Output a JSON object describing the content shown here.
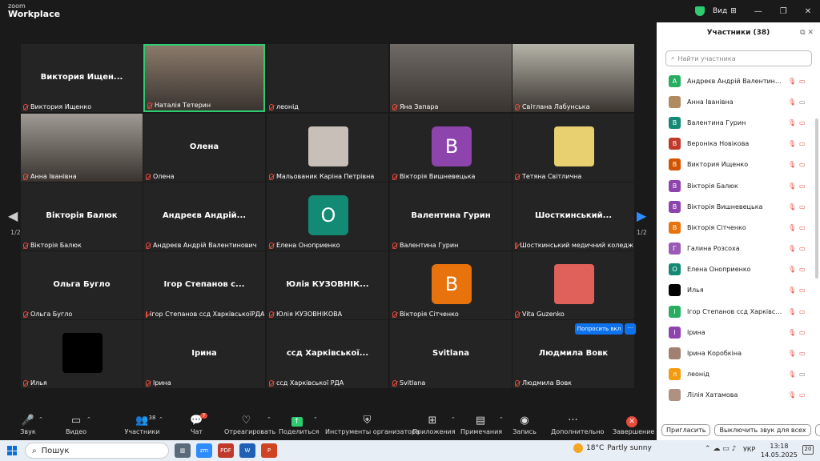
{
  "app": {
    "logo_top": "zoom",
    "logo_bottom": "Workplace",
    "view_label": "Вид",
    "win_controls": [
      "—",
      "❐",
      "✕"
    ]
  },
  "tiles": [
    {
      "name": "Виктория Ищен...",
      "label": "Виктория Ищенко",
      "kind": "name"
    },
    {
      "name": "",
      "label": "Наталія Тетерин",
      "kind": "video",
      "bg": "#8a7a6a",
      "active": true
    },
    {
      "name": "",
      "label": "леонід",
      "kind": "blank"
    },
    {
      "name": "",
      "label": "Яна Запара",
      "kind": "video",
      "bg": "#6f6a66"
    },
    {
      "name": "",
      "label": "Світлана Лабунська",
      "kind": "video",
      "bg": "#b5b4a8"
    },
    {
      "name": "",
      "label": "Анна Іванівна",
      "kind": "video",
      "bg": "#a09a94"
    },
    {
      "name": "Олена",
      "label": "Олена",
      "kind": "name"
    },
    {
      "name": "",
      "label": "Мальованик Каріна Петрівна",
      "kind": "thumb",
      "bg": "#c8c0b8"
    },
    {
      "name": "В",
      "label": "Вікторія Вишневецька",
      "kind": "avatar",
      "bg": "#8e44ad"
    },
    {
      "name": "",
      "label": "Тетяна Світлична",
      "kind": "thumb",
      "bg": "#e8d070"
    },
    {
      "name": "Вікторія Балюк",
      "label": "Вікторія Балюк",
      "kind": "name"
    },
    {
      "name": "Андреєв Андрій...",
      "label": "Андреєв Андрій Валентинович",
      "kind": "name"
    },
    {
      "name": "О",
      "label": "Елена Оноприенко",
      "kind": "avatar",
      "bg": "#138a74"
    },
    {
      "name": "Валентина Гурин",
      "label": "Валентина Гурин",
      "kind": "name"
    },
    {
      "name": "Шосткинський...",
      "label": "Шосткинський медичний коледж",
      "kind": "name"
    },
    {
      "name": "Ольга Бугло",
      "label": "Ольга Бугло",
      "kind": "name"
    },
    {
      "name": "Ігор Степанов с...",
      "label": "Ігор Степанов ссд ХарківськоїРДА",
      "kind": "name"
    },
    {
      "name": "Юлія КУЗОВНІК...",
      "label": "Юлія КУЗОВНІКОВА",
      "kind": "name"
    },
    {
      "name": "В",
      "label": "Вікторія Сітченко",
      "kind": "avatar",
      "bg": "#e8720c"
    },
    {
      "name": "",
      "label": "Vita Guzenko",
      "kind": "thumb",
      "bg": "#e0605a"
    },
    {
      "name": "",
      "label": "Илья",
      "kind": "thumb",
      "bg": "#000000"
    },
    {
      "name": "Ірина",
      "label": "Ірина",
      "kind": "name"
    },
    {
      "name": "ссд Харківської...",
      "label": "ссд Харківської РДА",
      "kind": "name"
    },
    {
      "name": "Svitlana",
      "label": "Svitlana",
      "kind": "name"
    },
    {
      "name": "Людмила Вовк",
      "label": "Людмила Вовк",
      "kind": "name"
    }
  ],
  "stage": {
    "page_left": "1/2",
    "page_right": "1/2",
    "ask_button": "Попросить вкл",
    "more": "···"
  },
  "toolbar": [
    {
      "label": "Звук",
      "icon": "🎤",
      "caret": true
    },
    {
      "label": "Видео",
      "icon": "▭",
      "caret": true
    },
    {
      "label": "Участники",
      "icon": "👥",
      "caret": true,
      "count": "38"
    },
    {
      "label": "Чат",
      "icon": "💬",
      "caret": false,
      "badge": "7"
    },
    {
      "label": "Отреагировать",
      "icon": "♡",
      "caret": true
    },
    {
      "label": "Поделиться",
      "icon": "↑",
      "caret": true
    },
    {
      "label": "Инструменты организатора",
      "icon": "⛨",
      "caret": false
    },
    {
      "label": "Приложения",
      "icon": "⊞",
      "caret": true
    },
    {
      "label": "Примечания",
      "icon": "▤",
      "caret": true
    },
    {
      "label": "Запись",
      "icon": "◉",
      "caret": false
    },
    {
      "label": "Дополнительно",
      "icon": "···",
      "caret": false
    },
    {
      "label": "Завершение",
      "icon": "✕",
      "caret": false
    }
  ],
  "panel": {
    "title": "Участники (38)",
    "search_placeholder": "Найти участника",
    "participants": [
      {
        "initial": "А",
        "name": "Андреєв Андрій Валентинович",
        "color": "#27ae60",
        "cam_on": false
      },
      {
        "initial": "",
        "name": "Анна Іванівна",
        "color": "#b08a60",
        "cam_on": true
      },
      {
        "initial": "В",
        "name": "Валентина Гурин",
        "color": "#138a74",
        "cam_on": false
      },
      {
        "initial": "В",
        "name": "Вероніка Новікова",
        "color": "#c0392b",
        "cam_on": false
      },
      {
        "initial": "В",
        "name": "Виктория Ищенко",
        "color": "#d35400",
        "cam_on": false
      },
      {
        "initial": "В",
        "name": "Вікторія Балюк",
        "color": "#8e44ad",
        "cam_on": false
      },
      {
        "initial": "В",
        "name": "Вікторія Вишневецька",
        "color": "#8e44ad",
        "cam_on": false
      },
      {
        "initial": "В",
        "name": "Вікторія Сітченко",
        "color": "#e8720c",
        "cam_on": false
      },
      {
        "initial": "Г",
        "name": "Галина Розсоха",
        "color": "#9b59b6",
        "cam_on": false
      },
      {
        "initial": "О",
        "name": "Елена Оноприенко",
        "color": "#138a74",
        "cam_on": false
      },
      {
        "initial": "",
        "name": "Илья",
        "color": "#000000",
        "cam_on": false
      },
      {
        "initial": "І",
        "name": "Ігор Степанов ссд Харківської...",
        "color": "#27ae60",
        "cam_on": false
      },
      {
        "initial": "І",
        "name": "Ірина",
        "color": "#8e44ad",
        "cam_on": false
      },
      {
        "initial": "",
        "name": "Ірина Коробкіна",
        "color": "#a08070",
        "cam_on": false
      },
      {
        "initial": "л",
        "name": "леонід",
        "color": "#f39c12",
        "cam_on": true
      },
      {
        "initial": "",
        "name": "Лілія Хатамова",
        "color": "#b09080",
        "cam_on": false
      }
    ],
    "invite": "Пригласить",
    "mute_all": "Выключить звук для всех",
    "more": "···"
  },
  "taskbar": {
    "search": "Пошук",
    "weather_temp": "18°C",
    "weather_desc": "Partly sunny",
    "lang": "УКР",
    "time": "13:18",
    "date": "14.05.2025",
    "notif": "20",
    "apps": [
      {
        "label": "zm",
        "color": "#2d8cff"
      },
      {
        "label": "PDF",
        "color": "#c0392b"
      },
      {
        "label": "W",
        "color": "#1f5fb4"
      },
      {
        "label": "P",
        "color": "#d04423"
      }
    ]
  }
}
